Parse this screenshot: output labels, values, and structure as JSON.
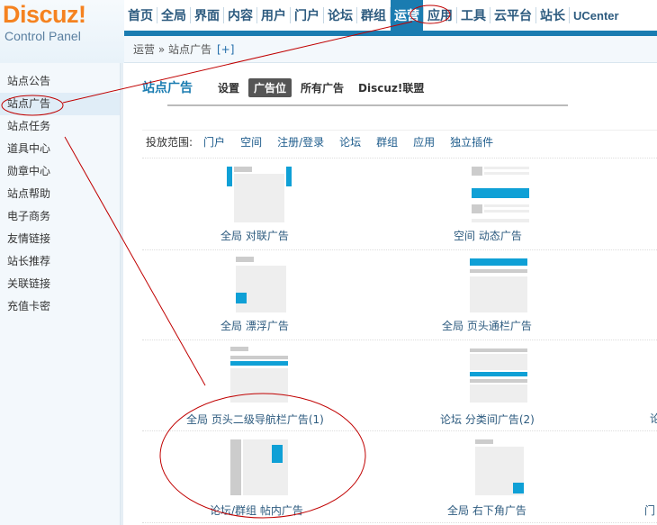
{
  "logo": {
    "brand": "Discuz!",
    "sub": "Control Panel"
  },
  "topnav": [
    {
      "label": "首页"
    },
    {
      "label": "全局"
    },
    {
      "label": "界面"
    },
    {
      "label": "内容"
    },
    {
      "label": "用户"
    },
    {
      "label": "门户"
    },
    {
      "label": "论坛"
    },
    {
      "label": "群组"
    },
    {
      "label": "运营",
      "active": true
    },
    {
      "label": "应用"
    },
    {
      "label": "工具"
    },
    {
      "label": "云平台"
    },
    {
      "label": "站长"
    },
    {
      "label": "UCenter"
    }
  ],
  "breadcrumb": {
    "path": "运营 » 站点广告",
    "add": "[+]"
  },
  "sidebar": {
    "items": [
      {
        "label": "站点公告"
      },
      {
        "label": "站点广告",
        "active": true
      },
      {
        "label": "站点任务"
      },
      {
        "label": "道具中心"
      },
      {
        "label": "勋章中心"
      },
      {
        "label": "站点帮助"
      },
      {
        "label": "电子商务"
      },
      {
        "label": "友情链接"
      },
      {
        "label": "站长推荐"
      },
      {
        "label": "关联链接"
      },
      {
        "label": "充值卡密"
      }
    ]
  },
  "page": {
    "title": "站点广告",
    "tabs": [
      {
        "label": "设置"
      },
      {
        "label": "广告位",
        "active": true
      },
      {
        "label": "所有广告"
      },
      {
        "label": "Discuz!联盟"
      }
    ]
  },
  "filter": {
    "label": "投放范围:",
    "links": [
      "门户",
      "空间",
      "注册/登录",
      "论坛",
      "群组",
      "应用",
      "独立插件"
    ]
  },
  "slots": {
    "couplet": "全局  对联广告",
    "feed": "空间  动态广告",
    "float": "全局  漂浮广告",
    "headbanner": "全局  页头通栏广告",
    "subnavbanner": "全局  页头二级导航栏广告(1)",
    "interthread": "论坛  分类间广告(2)",
    "inpost": "论坛/群组  帖内广告",
    "cornerbottom": "全局  右下角广告",
    "edge1": "论",
    "edge2": "门"
  },
  "colors": {
    "accent": "#1a7cb1",
    "slotblue": "#0fa0d6",
    "annotation": "#c00000",
    "logo": "#f58220"
  }
}
